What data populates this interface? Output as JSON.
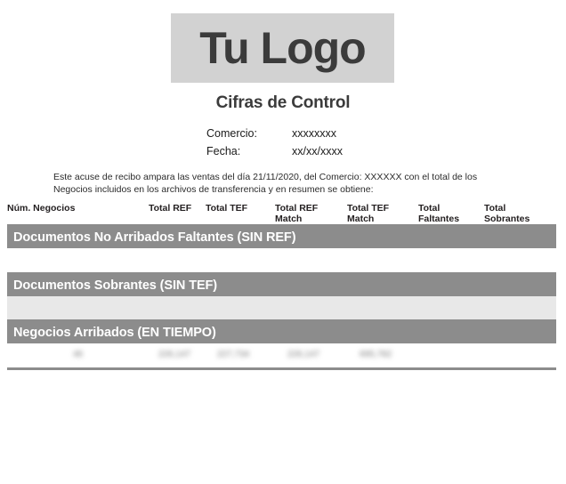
{
  "document": {
    "logo_placeholder": "Tu Logo",
    "title": "Cifras de Control",
    "meta": [
      {
        "label": "Comercio:",
        "value": "xxxxxxxx"
      },
      {
        "label": "Fecha:",
        "value": "xx/xx/xxxx"
      }
    ],
    "blurb": "Este acuse de recibo ampara las ventas del día 21/11/2020, del Comercio: XXXXXX con el total de los Negocios incluidos en los archivos de transferencia y en resumen se obtiene:"
  },
  "table": {
    "columns": [
      "Núm. Negocios",
      "Total REF",
      "Total TEF",
      "Total REF Match",
      "Total TEF Match",
      "Total Faltantes",
      "Total Sobrantes"
    ],
    "sections": [
      {
        "title": "Documentos No Arribados Faltantes (SIN REF)",
        "rows": []
      },
      {
        "title": "Documentos Sobrantes (SIN TEF)",
        "rows": []
      },
      {
        "title": "Negocios Arribados (EN TIEMPO)",
        "rows": [
          {
            "num_negocios": "46",
            "total_ref": "226,147",
            "total_tef": "227,734",
            "total_ref_match": "226,147",
            "total_tef_match": "695,782",
            "total_faltantes": "",
            "total_sobrantes": ""
          }
        ]
      }
    ]
  },
  "colors": {
    "section_bar": "#8c8c8c",
    "logo_box": "#d2d2d2",
    "shade_row": "#e8e8e8",
    "rule": "#8c8c8c",
    "text": "#231f20"
  }
}
